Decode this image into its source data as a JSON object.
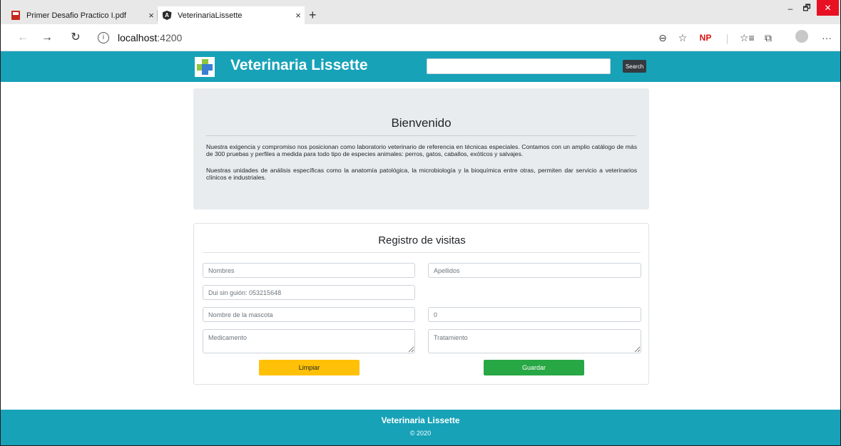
{
  "browser": {
    "tabs": [
      {
        "title": "Primer Desafio Practico I.pdf",
        "icon": "pdf-icon",
        "close": "×"
      },
      {
        "title": "VeterinariaLissette",
        "icon": "angular-icon",
        "close": "×"
      }
    ],
    "new_tab": "+",
    "window_controls": {
      "minimize": "–",
      "maximize": "🗗",
      "close": "✕"
    },
    "nav": {
      "back": "←",
      "forward": "→",
      "refresh": "↻",
      "info": "i"
    },
    "address": {
      "host": "localhost",
      "port": ":4200"
    },
    "toolbar_icons": {
      "zoom": "⊖",
      "favorite": "☆",
      "extension": "NP",
      "favorites": "☆≡",
      "collections": "⧉",
      "more": "···"
    }
  },
  "navbar": {
    "brand": "Veterinaria Lissette",
    "search_placeholder": "",
    "search_button": "Search"
  },
  "jumbotron": {
    "title": "Bienvenido",
    "paragraph_1": "Nuestra exigencia y compromiso nos posicionan como laboratorio veterinario de referencia en técnicas especiales. Contamos con un amplio catálogo de más de 300 pruebas y perfiles a medida para todo tipo de especies animales: perros, gatos, caballos, exóticos y salvajes.",
    "paragraph_2": "Nuestras unidades de análisis específicas como la anatomía patológica, la microbiología y la bioquímica entre otras, permiten dar servicio a veterinarios clínicos e industriales."
  },
  "form": {
    "title": "Registro de visitas",
    "nombres_placeholder": "Nombres",
    "apellidos_placeholder": "Apellidos",
    "dui_placeholder": "Dui sin guión: 053215648",
    "mascota_placeholder": "Nombre de la mascota",
    "numero_value": "0",
    "medicamento_placeholder": "Medicamento",
    "tratamiento_placeholder": "Tratamiento",
    "clear_label": "Limpiar",
    "save_label": "Guardar"
  },
  "footer": {
    "brand": "Veterinaria Lissette",
    "copyright": "© 2020"
  },
  "colors": {
    "primary": "#17a2b8",
    "warning": "#ffc107",
    "success": "#28a745",
    "dark": "#343a40",
    "jumbotron": "#e9ecef"
  }
}
